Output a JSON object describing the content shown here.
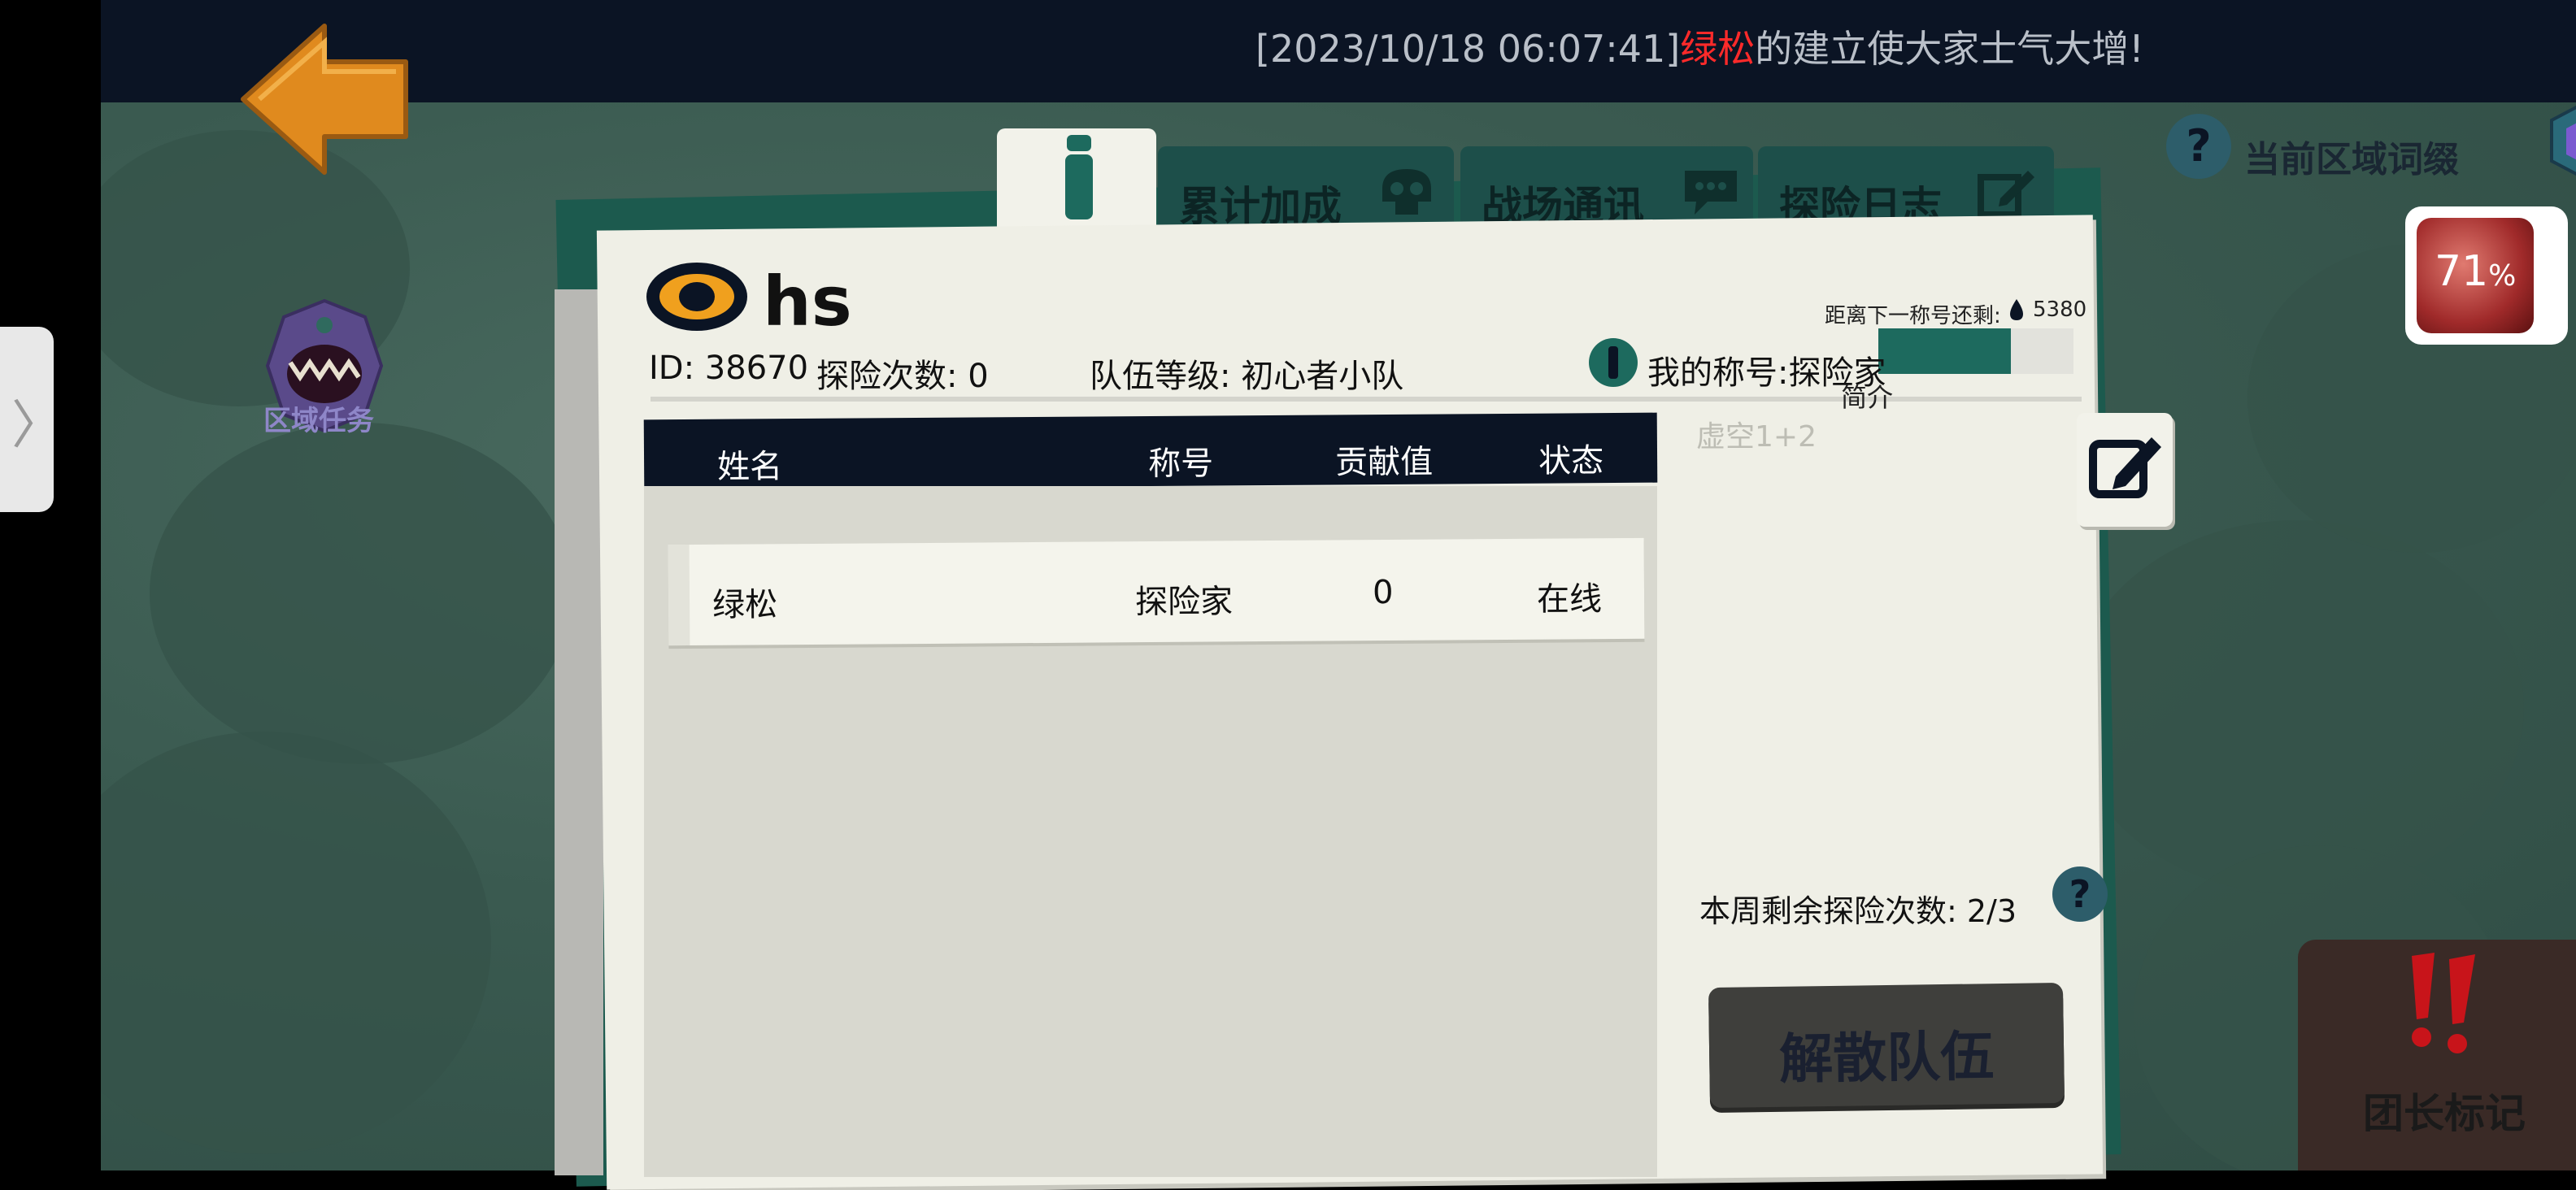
{
  "broadcast": {
    "timestamp": "[2023/10/18 06:07:41]",
    "player": "绿松",
    "message": "的建立使大家士气大增!"
  },
  "left_menu": {
    "area_task_label": "区域任务"
  },
  "region": {
    "label": "当前区域词缀",
    "help_glyph": "?"
  },
  "progress_badge": {
    "value": "71",
    "unit": "%"
  },
  "tabs": [
    {
      "label": "累计加成",
      "icon": "skull-icon"
    },
    {
      "label": "战场通讯",
      "icon": "chat-icon"
    },
    {
      "label": "探险日志",
      "icon": "edit-icon"
    }
  ],
  "team": {
    "name": "hs",
    "id_text": "ID: 38670",
    "explore_count_text": "探险次数: 0",
    "team_level_text": "队伍等级: 初心者小队",
    "next_title_label": "距离下一称号还剩:",
    "next_title_value": "5380",
    "my_title_text": "我的称号:探险家",
    "title_progress": 0.68,
    "intro_label": "简介",
    "intro_text": "虚空1+2",
    "weekly_remaining_text": "本周剩余探险次数: 2/3"
  },
  "table": {
    "headers": [
      "姓名",
      "称号",
      "贡献值",
      "状态"
    ],
    "rows": [
      {
        "name": "绿松",
        "title": "探险家",
        "contribution": "0",
        "status": "在线"
      }
    ]
  },
  "buttons": {
    "disband_label": "解散队伍",
    "leader_mark_label": "团长标记"
  },
  "colors": {
    "accent_teal": "#1d6a5e",
    "highlight_red": "#ff2a2a",
    "header_dark": "#0b1424"
  }
}
